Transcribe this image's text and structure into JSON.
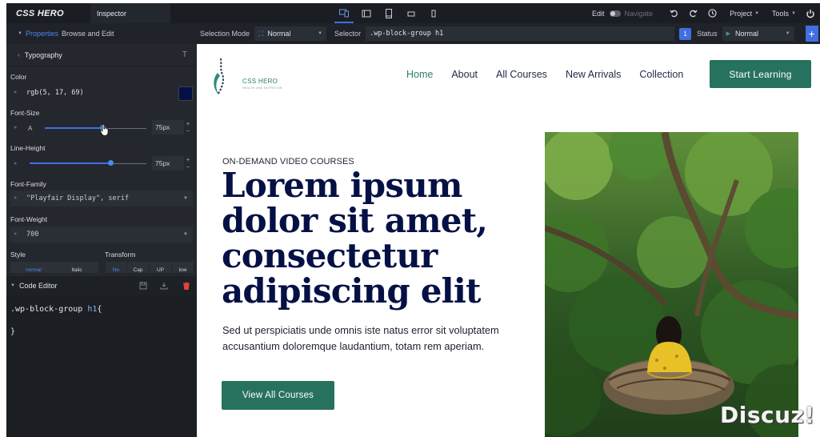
{
  "topbar": {
    "app_name": "CSS HERO",
    "tab_label": "Inspector",
    "edit_label": "Edit",
    "navigate_label": "Navigate",
    "project_label": "Project",
    "tools_label": "Tools"
  },
  "toolbar": {
    "properties_label": "Properties",
    "browse_label": "Browse and Edit",
    "selection_mode_label": "Selection Mode",
    "selection_mode_value": "Normal",
    "selector_label": "Selector",
    "selector_value": ".wp-block-group h1",
    "badge_count": "1",
    "status_label": "Status",
    "status_value": "Normal",
    "plus_label": "+"
  },
  "panel": {
    "section_title": "Typography",
    "color_label": "Color",
    "color_value": "rgb(5, 17, 69)",
    "color_swatch": "#051145",
    "font_size_label": "Font-Size",
    "font_size_value": "75px",
    "font_size_level": 0.57,
    "line_height_label": "Line-Height",
    "line_height_value": "75px",
    "line_height_level": 0.69,
    "font_family_label": "Font-Family",
    "font_family_value": "\"Playfair Display\", serif",
    "font_weight_label": "Font-Weight",
    "font_weight_value": "700",
    "style_label": "Style",
    "style_options": [
      "normal",
      "Italic"
    ],
    "transform_label": "Transform",
    "transform_options": [
      "No",
      "Cap",
      "UP",
      "low"
    ]
  },
  "code_editor": {
    "title": "Code Editor",
    "line1_selector": ".wp-block-group ",
    "line1_tag": "h1",
    "line1_brace": "{",
    "line2": "}"
  },
  "site": {
    "logo_name": "CSS HERO",
    "logo_tagline": "HEALTH AND NUTRITION",
    "nav": [
      "Home",
      "About",
      "All Courses",
      "New Arrivals",
      "Collection"
    ],
    "cta_label": "Start Learning",
    "eyebrow": "ON-DEMAND VIDEO COURSES",
    "hero_lines": [
      "Lorem ipsum",
      "dolor sit amet,",
      "consectetur",
      "adipiscing elit"
    ],
    "hero_text": "Sed ut perspiciatis unde omnis iste natus error sit voluptatem accusantium doloremque laudantium, totam rem aperiam.",
    "hero_button": "View All Courses",
    "brand_color": "#27725f",
    "heading_color": "#051145"
  },
  "watermark": "Discuz!"
}
